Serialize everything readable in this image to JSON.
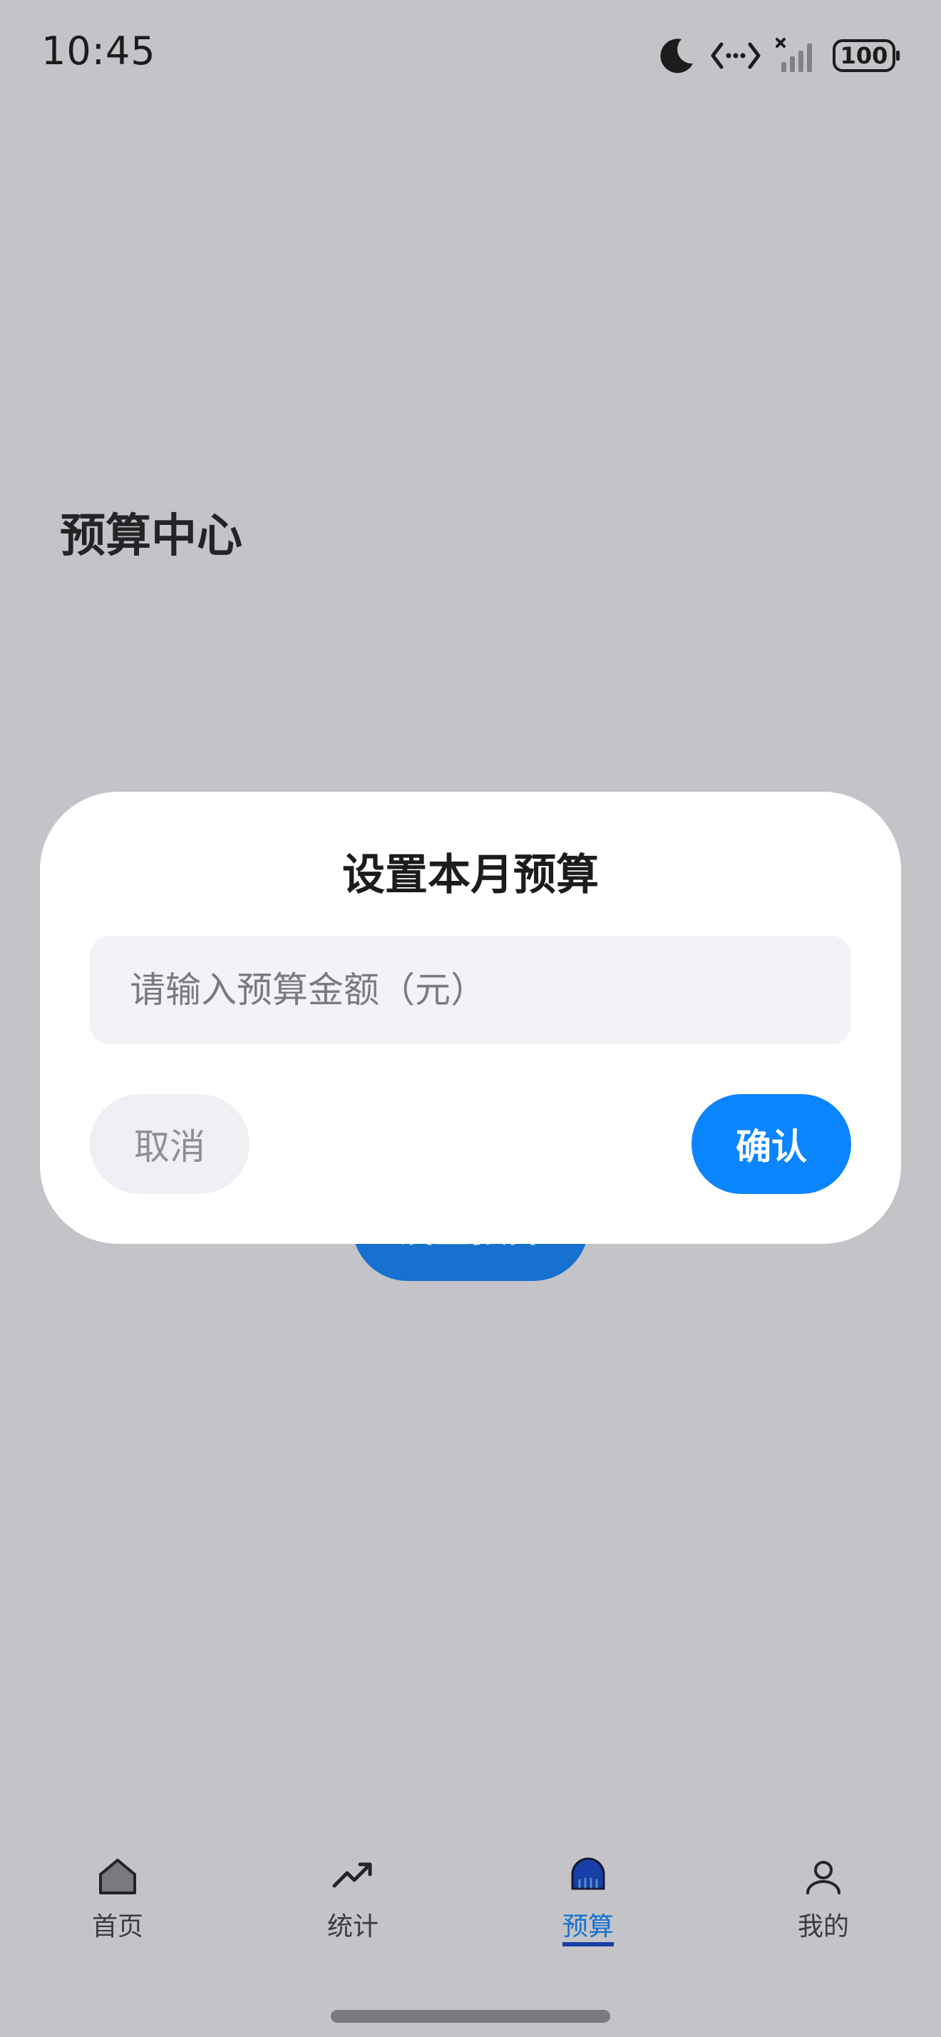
{
  "status_bar": {
    "time": "10:45",
    "battery": "100",
    "icons": [
      "moon-icon",
      "data-transfer-icon",
      "cellular-no-signal-icon",
      "battery-icon"
    ]
  },
  "page": {
    "title": "预算中心",
    "set_budget_button": "设置预算"
  },
  "dialog": {
    "title": "设置本月预算",
    "input_placeholder": "请输入预算金额（元）",
    "input_value": "",
    "cancel_label": "取消",
    "confirm_label": "确认"
  },
  "tabbar": {
    "active": "预算",
    "items": [
      {
        "label": "首页",
        "icon": "home-icon"
      },
      {
        "label": "统计",
        "icon": "trend-icon"
      },
      {
        "label": "预算",
        "icon": "wallet-icon"
      },
      {
        "label": "我的",
        "icon": "person-icon"
      }
    ]
  },
  "colors": {
    "accent": "#0a84ff",
    "overlay": "#c3c3c8",
    "dialog": "#ffffff",
    "input_bg": "#f2f2f7"
  }
}
